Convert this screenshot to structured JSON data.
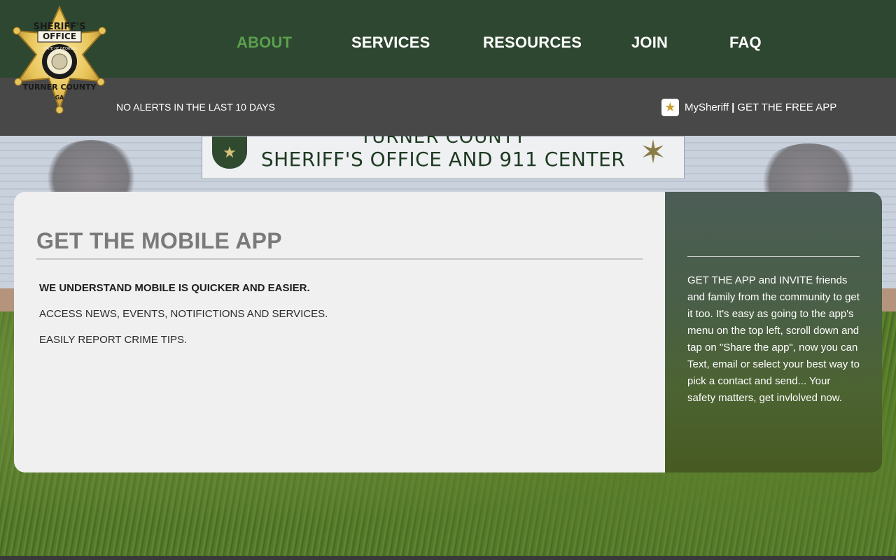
{
  "logo": {
    "arc_top": "SHERIFF'S",
    "office": "OFFICE",
    "seal_text": "STATE OF GEORGIA",
    "county": "TURNER COUNTY",
    "state_abbr": "GA"
  },
  "nav": {
    "items": [
      {
        "label": "ABOUT",
        "active": true
      },
      {
        "label": "SERVICES",
        "active": false
      },
      {
        "label": "RESOURCES",
        "active": false
      },
      {
        "label": "JOIN",
        "active": false
      },
      {
        "label": "FAQ",
        "active": false
      }
    ]
  },
  "alerts": {
    "text": "NO ALERTS IN THE LAST 10 DAYS"
  },
  "app_link": {
    "brand": "MySheriff",
    "separator": "|",
    "cta": "GET THE FREE APP"
  },
  "background_sign": {
    "line1": "TURNER COUNTY",
    "line2": "SHERIFF'S OFFICE AND 911 CENTER"
  },
  "main": {
    "title": "GET THE MOBILE APP",
    "lines": [
      "WE UNDERSTAND MOBILE IS QUICKER AND EASIER.",
      "ACCESS NEWS, EVENTS, NOTIFICTIONS AND SERVICES.",
      "EASILY REPORT CRIME TIPS."
    ],
    "side_text": "GET THE APP and INVITE friends and family from the community to get it too. It's easy as going to the app's menu on the top left, scroll down and tap on \"Share the app\", now you can Text, email or select your best way to pick a contact and send... Your safety matters, get invlolved now."
  },
  "colors": {
    "topbar": "#2e4730",
    "nav_active": "#5ba04e",
    "alertbar": "#484848",
    "card_left": "#f0f0f1",
    "card_right": "#475a22",
    "badge_gold": "#e8c55a"
  }
}
